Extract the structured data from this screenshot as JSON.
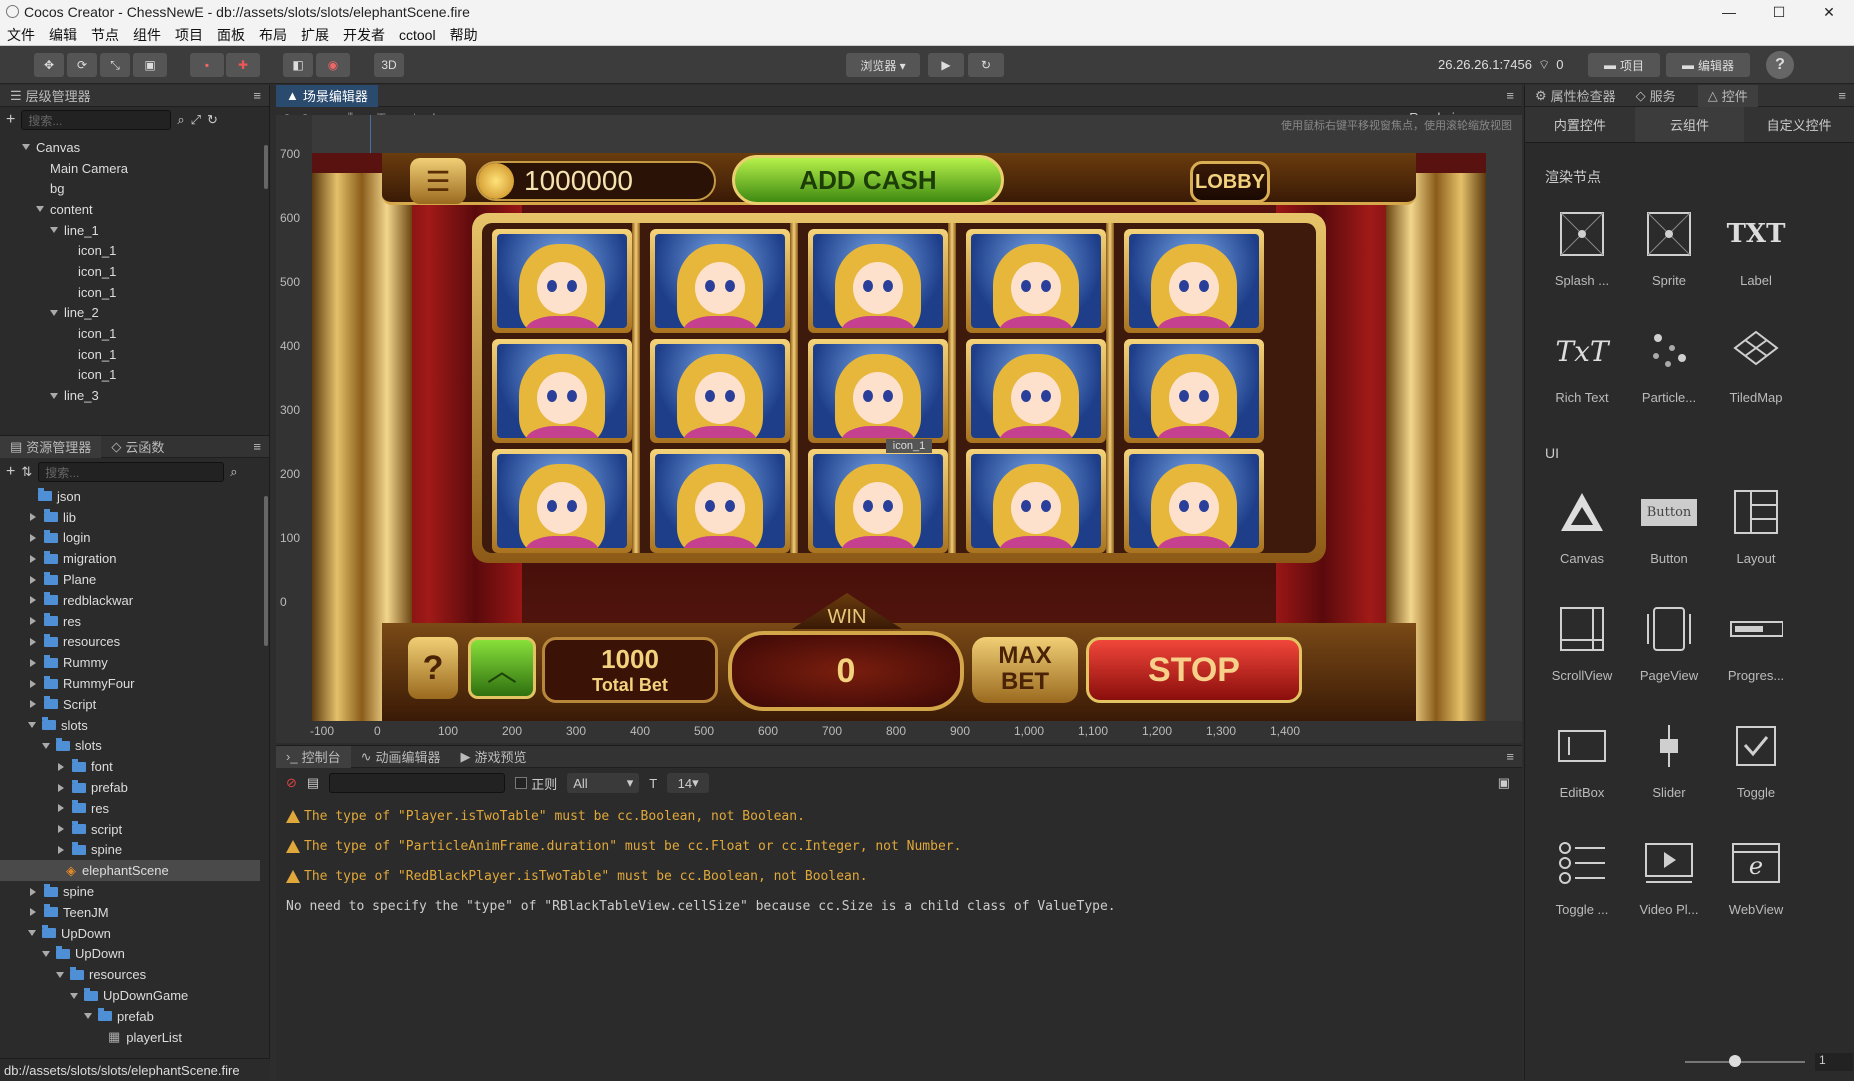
{
  "window": {
    "title": "Cocos Creator - ChessNewE - db://assets/slots/slots/elephantScene.fire",
    "minimize": "—",
    "maximize": "☐",
    "close": "✕"
  },
  "menu": [
    "文件",
    "编辑",
    "节点",
    "组件",
    "项目",
    "面板",
    "布局",
    "扩展",
    "开发者",
    "cctool",
    "帮助"
  ],
  "toolbar": {
    "mode3d": "3D",
    "browser": "浏览器 ▾",
    "ip": "26.26.26.1:7456",
    "wifi_count": "0",
    "project_btn": "项目",
    "editor_btn": "编辑器",
    "help": "?"
  },
  "hierarchy": {
    "title": "层级管理器",
    "search_placeholder": "搜索...",
    "nodes": [
      {
        "label": "Canvas",
        "depth": 0,
        "arrow": "down"
      },
      {
        "label": "Main Camera",
        "depth": 1,
        "arrow": ""
      },
      {
        "label": "bg",
        "depth": 1,
        "arrow": ""
      },
      {
        "label": "content",
        "depth": 1,
        "arrow": "down"
      },
      {
        "label": "line_1",
        "depth": 2,
        "arrow": "down"
      },
      {
        "label": "icon_1",
        "depth": 3,
        "arrow": ""
      },
      {
        "label": "icon_1",
        "depth": 3,
        "arrow": ""
      },
      {
        "label": "icon_1",
        "depth": 3,
        "arrow": ""
      },
      {
        "label": "line_2",
        "depth": 2,
        "arrow": "down"
      },
      {
        "label": "icon_1",
        "depth": 3,
        "arrow": ""
      },
      {
        "label": "icon_1",
        "depth": 3,
        "arrow": ""
      },
      {
        "label": "icon_1",
        "depth": 3,
        "arrow": ""
      },
      {
        "label": "line_3",
        "depth": 2,
        "arrow": "down"
      }
    ]
  },
  "assets": {
    "tab1": "资源管理器",
    "tab2": "云函数",
    "search_placeholder": "搜索...",
    "items": [
      {
        "label": "json",
        "depth": 0,
        "arrow": ""
      },
      {
        "label": "lib",
        "depth": 0,
        "arrow": "right"
      },
      {
        "label": "login",
        "depth": 0,
        "arrow": "right"
      },
      {
        "label": "migration",
        "depth": 0,
        "arrow": "right"
      },
      {
        "label": "Plane",
        "depth": 0,
        "arrow": "right"
      },
      {
        "label": "redblackwar",
        "depth": 0,
        "arrow": "right"
      },
      {
        "label": "res",
        "depth": 0,
        "arrow": "right"
      },
      {
        "label": "resources",
        "depth": 0,
        "arrow": "right"
      },
      {
        "label": "Rummy",
        "depth": 0,
        "arrow": "right"
      },
      {
        "label": "RummyFour",
        "depth": 0,
        "arrow": "right"
      },
      {
        "label": "Script",
        "depth": 0,
        "arrow": "right"
      },
      {
        "label": "slots",
        "depth": 0,
        "arrow": "down"
      },
      {
        "label": "slots",
        "depth": 1,
        "arrow": "down"
      },
      {
        "label": "font",
        "depth": 2,
        "arrow": "right"
      },
      {
        "label": "prefab",
        "depth": 2,
        "arrow": "right"
      },
      {
        "label": "res",
        "depth": 2,
        "arrow": "right"
      },
      {
        "label": "script",
        "depth": 2,
        "arrow": "right"
      },
      {
        "label": "spine",
        "depth": 2,
        "arrow": "right"
      },
      {
        "label": "elephantScene",
        "depth": 2,
        "arrow": "",
        "selected": true,
        "scene": true
      },
      {
        "label": "spine",
        "depth": 0,
        "arrow": "right"
      },
      {
        "label": "TeenJM",
        "depth": 0,
        "arrow": "right"
      },
      {
        "label": "UpDown",
        "depth": 0,
        "arrow": "down"
      },
      {
        "label": "UpDown",
        "depth": 1,
        "arrow": "down"
      },
      {
        "label": "resources",
        "depth": 2,
        "arrow": "down"
      },
      {
        "label": "UpDownGame",
        "depth": 3,
        "arrow": "down"
      },
      {
        "label": "prefab",
        "depth": 4,
        "arrow": "down"
      },
      {
        "label": "playerList",
        "depth": 5,
        "arrow": "",
        "file": true
      }
    ],
    "status": "db://assets/slots/slots/elephantScene.fire"
  },
  "scene_editor": {
    "tab": "场景编辑器",
    "rendering": "Rendering",
    "hint": "使用鼠标右键平移视窗焦点，使用滚轮缩放视图",
    "ruler_y": [
      "700",
      "600",
      "500",
      "400",
      "300",
      "200",
      "100",
      "0"
    ],
    "ruler_x": [
      "-100",
      "0",
      "100",
      "200",
      "300",
      "400",
      "500",
      "600",
      "700",
      "800",
      "900",
      "1,000",
      "1,100",
      "1,200",
      "1,300",
      "1,400"
    ],
    "game": {
      "coins": "1000000",
      "add_cash": "ADD CASH",
      "lobby": "LOBBY",
      "help": "?",
      "total_bet_value": "1000",
      "total_bet_label": "Total Bet",
      "win_label": "WIN",
      "win_value": "0",
      "max": "MAX",
      "bet": "BET",
      "stop": "STOP",
      "selected_node_label": "icon_1"
    }
  },
  "console": {
    "tabs": [
      "控制台",
      "动画编辑器",
      "游戏预览"
    ],
    "regex": "正则",
    "level": "All",
    "fontsize": "14",
    "logs": [
      {
        "type": "warn",
        "text": "The type of \"Player.isTwoTable\" must be cc.Boolean, not Boolean."
      },
      {
        "type": "warn",
        "text": "The type of \"ParticleAnimFrame.duration\" must be cc.Float or cc.Integer, not Number."
      },
      {
        "type": "warn",
        "text": "The type of \"RedBlackPlayer.isTwoTable\" must be cc.Boolean, not Boolean."
      },
      {
        "type": "info",
        "text": "No need to specify the \"type\" of \"RBlackTableView.cellSize\" because cc.Size is a child class of ValueType."
      }
    ]
  },
  "right_panel": {
    "tabs": [
      "属性检查器",
      "服务",
      "控件"
    ],
    "subtabs": [
      "内置控件",
      "云组件",
      "自定义控件"
    ],
    "section_render": "渲染节点",
    "section_ui": "UI",
    "render_items": [
      {
        "label": "Splash ...",
        "icon": "splash-icon"
      },
      {
        "label": "Sprite",
        "icon": "sprite-icon"
      },
      {
        "label": "Label",
        "icon": "label-icon",
        "glyph": "TXT"
      },
      {
        "label": "Rich Text",
        "icon": "richtext-icon",
        "glyph": "TxT"
      },
      {
        "label": "Particle...",
        "icon": "particle-icon"
      },
      {
        "label": "TiledMap",
        "icon": "tiledmap-icon"
      }
    ],
    "ui_items": [
      {
        "label": "Canvas",
        "icon": "canvas-icon"
      },
      {
        "label": "Button",
        "icon": "button-icon",
        "glyph": "Button"
      },
      {
        "label": "Layout",
        "icon": "layout-icon"
      },
      {
        "label": "ScrollView",
        "icon": "scrollview-icon"
      },
      {
        "label": "PageView",
        "icon": "pageview-icon"
      },
      {
        "label": "Progres...",
        "icon": "progressbar-icon"
      },
      {
        "label": "EditBox",
        "icon": "editbox-icon"
      },
      {
        "label": "Slider",
        "icon": "slider-icon"
      },
      {
        "label": "Toggle",
        "icon": "toggle-icon"
      },
      {
        "label": "Toggle ...",
        "icon": "togglegroup-icon"
      },
      {
        "label": "Video Pl...",
        "icon": "videoplayer-icon"
      },
      {
        "label": "WebView",
        "icon": "webview-icon",
        "glyph": "e"
      }
    ],
    "zoom_value": "1"
  }
}
